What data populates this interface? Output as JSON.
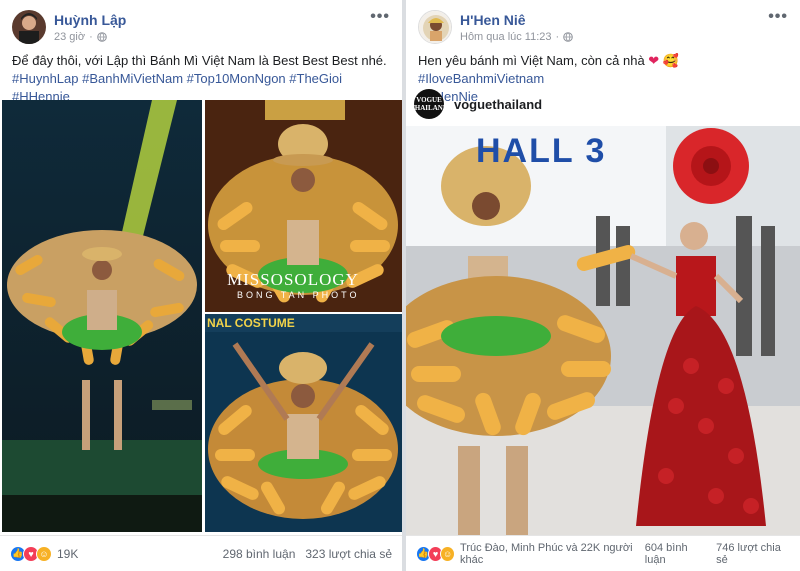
{
  "left_post": {
    "author": "Huỳnh Lập",
    "time": "23 giờ",
    "more_label": "•••",
    "text": "Để đây thôi, với Lập thì Bánh Mì Việt Nam là Best Best Best nhé.",
    "hashtags": "#HuynhLap #BanhMiVietNam #Top10MonNgon #TheGioi #HHennie",
    "watermark_1": "MISSOSOLOGY",
    "watermark_2": "BONG TAN PHOTO",
    "banner_text": "NAL COSTUME",
    "reaction_count": "19K",
    "comments": "298 bình luận",
    "shares": "323 lượt chia sẻ"
  },
  "right_post": {
    "author": "H'Hen Niê",
    "time": "Hôm qua lúc 11:23",
    "more_label": "•••",
    "text": "Hen yêu bánh mì Việt Nam, còn cả nhà",
    "hashtags_inline": "#IloveBanhmiVietnam",
    "hashtags": "#HHenNie",
    "ig_logo": "VOGUE THAILAND",
    "ig_name": "voguethailand",
    "hall_text": "HALL 3",
    "reaction_summary": "Trúc Đào, Minh Phúc và 22K người khác",
    "comments": "604 bình luận",
    "shares": "746 lượt chia sẻ"
  },
  "colors": {
    "link": "#385898",
    "like": "#1877f2",
    "love": "#f33e58",
    "haha": "#f7b125"
  },
  "icons": [
    "globe-icon",
    "more-icon",
    "like-icon",
    "love-icon",
    "haha-icon",
    "heart-icon"
  ]
}
